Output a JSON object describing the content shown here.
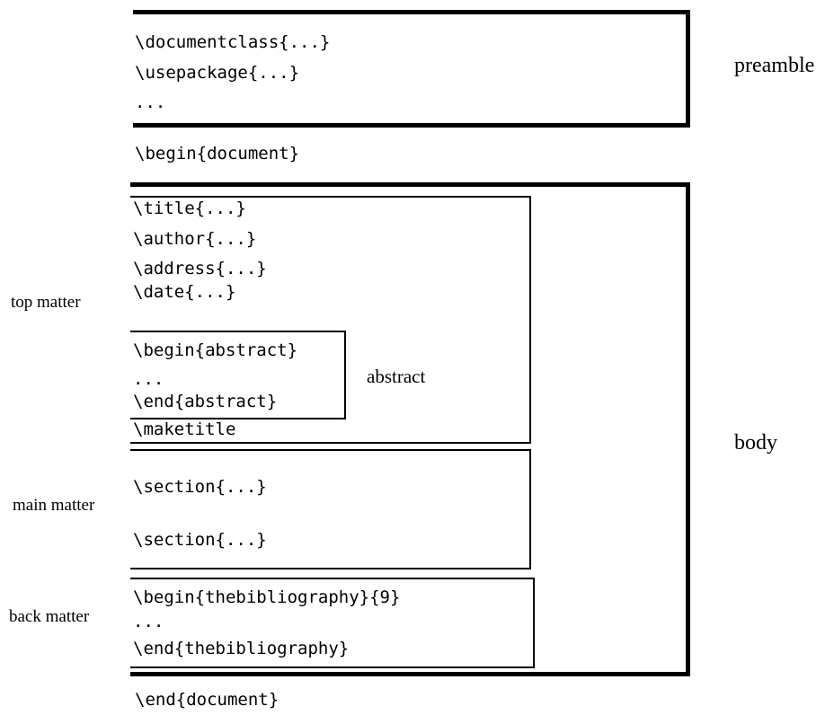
{
  "preamble": {
    "lines": [
      "\\documentclass{...}",
      "\\usepackage{...}",
      "..."
    ],
    "label": "preamble"
  },
  "begin_document": "\\begin{document}",
  "end_document": "\\end{document}",
  "body_label": "body",
  "top_matter": {
    "label": "top matter",
    "lines": [
      "\\title{...}",
      "\\author{...}",
      "\\address{...}",
      "\\date{...}"
    ],
    "abstract": {
      "lines": [
        "\\begin{abstract}",
        "...",
        "\\end{abstract}"
      ],
      "label": "abstract"
    },
    "maketitle": "\\maketitle"
  },
  "main_matter": {
    "label": "main matter",
    "sections": [
      "\\section{...}",
      "\\section{...}"
    ]
  },
  "back_matter": {
    "label": "back matter",
    "lines": [
      "\\begin{thebibliography}{9}",
      "...",
      "\\end{thebibliography}"
    ]
  }
}
